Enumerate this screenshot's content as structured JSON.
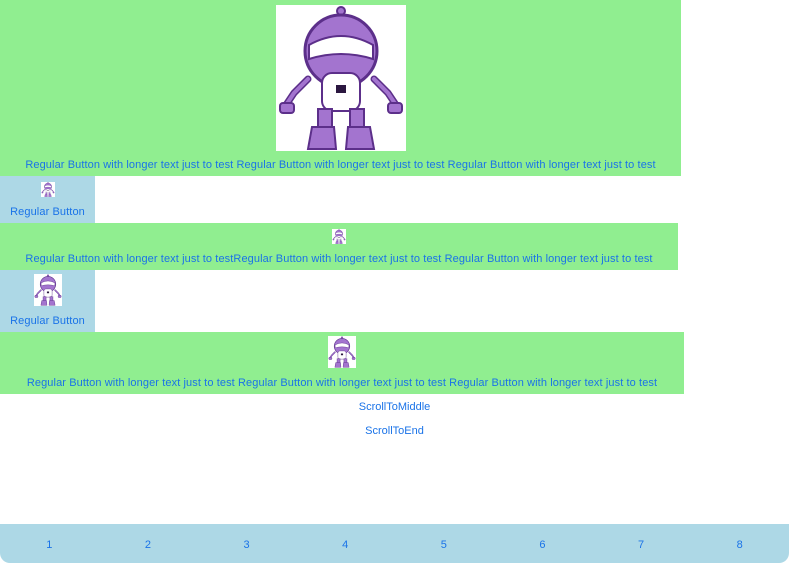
{
  "buttons": [
    {
      "label": "Regular Button with longer text just to test Regular Button with longer text just to test Regular Button with longer text just to test",
      "icon": "robot-icon"
    },
    {
      "label": "Regular Button",
      "icon": "robot-icon"
    },
    {
      "label": "Regular Button with longer text just to testRegular Button with longer text just to test Regular Button with longer text just to test",
      "icon": "robot-icon"
    },
    {
      "label": "Regular Button",
      "icon": "robot-icon"
    },
    {
      "label": "Regular Button with longer text just to test Regular Button with longer text just to test Regular Button with longer text just to test",
      "icon": "robot-icon"
    }
  ],
  "links": {
    "scroll_middle": "ScrollToMiddle",
    "scroll_end": "ScrollToEnd"
  },
  "tabs": [
    "1",
    "2",
    "3",
    "4",
    "5",
    "6",
    "7",
    "8"
  ],
  "colors": {
    "green": "#90ee90",
    "light_blue": "#add8e6",
    "link": "#1a73e8",
    "robot_purple": "#a374cf"
  }
}
